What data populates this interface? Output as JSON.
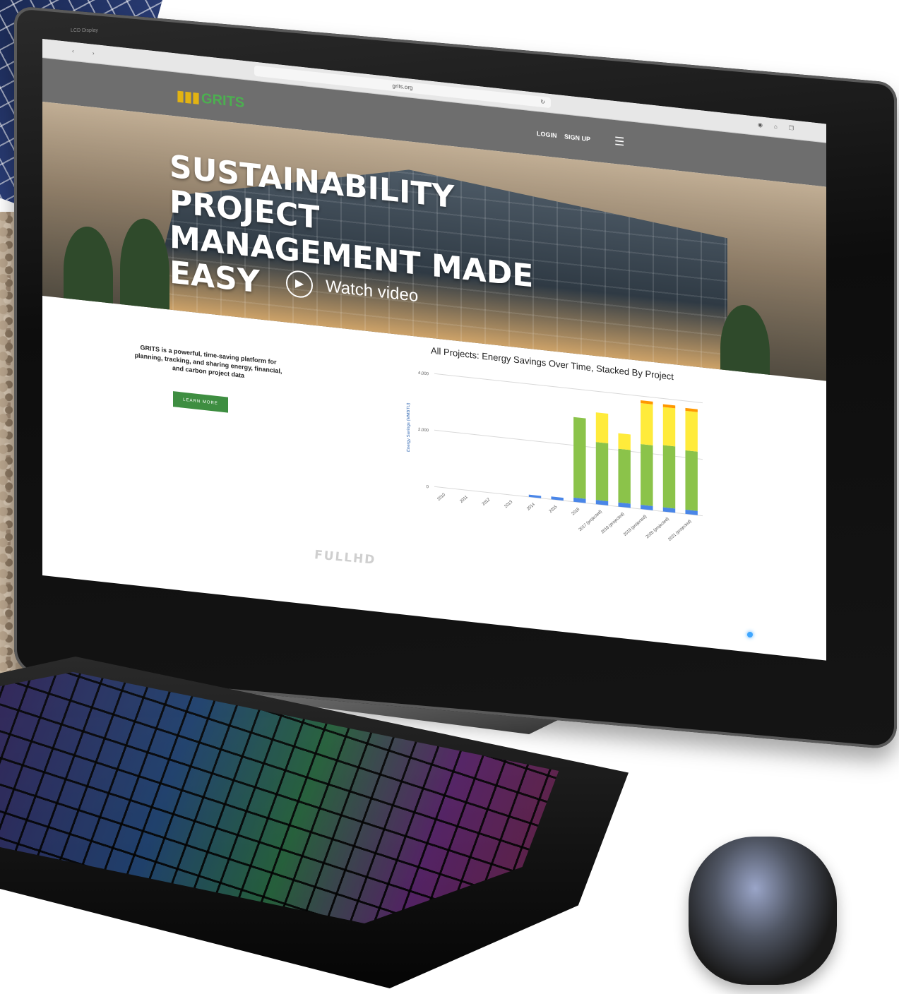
{
  "monitor": {
    "label": "LCD Display",
    "brand": "FULLHD"
  },
  "browser": {
    "url": "grits.org",
    "reload_icon": "reload-icon",
    "tool_icons": [
      "circle-icon",
      "home-icon",
      "pages-icon"
    ]
  },
  "site": {
    "logo_text": "GRITS",
    "nav": {
      "login": "LOGIN",
      "signup": "SIGN UP",
      "menu_icon": "hamburger-icon"
    },
    "hero": {
      "title_line1": "SUSTAINABILITY PROJECT",
      "title_line2": "MANAGEMENT MADE EASY",
      "watch_video": "Watch video"
    },
    "intro": "GRITS is a powerful, time-saving platform for planning, tracking, and sharing energy, financial, and carbon project data",
    "learn_more": "LEARN MORE"
  },
  "colors": {
    "brand_green": "#4caf50",
    "button_green": "#3e8e41",
    "nav_gray": "#6e6e6e"
  },
  "chart_data": {
    "type": "bar",
    "title": "All Projects: Energy Savings Over Time, Stacked By Project",
    "ylabel": "Energy Savings (MMBTU)",
    "ylim": [
      0,
      4000
    ],
    "yticks": [
      "4,000",
      "2,000",
      "0"
    ],
    "categories": [
      "2010",
      "2011",
      "2012",
      "2013",
      "2014",
      "2015",
      "2016",
      "2017 (projected)",
      "2018 (projected)",
      "2019 (projected)",
      "2020 (projected)",
      "2021 (projected)"
    ],
    "series": [
      {
        "color": "#4a86e8",
        "values": [
          0,
          0,
          0,
          0,
          80,
          100,
          150,
          150,
          150,
          150,
          150,
          150
        ]
      },
      {
        "color": "#8bc34a",
        "values": [
          0,
          0,
          0,
          0,
          0,
          0,
          2850,
          2050,
          1900,
          2150,
          2200,
          2100
        ]
      },
      {
        "color": "#ffeb3b",
        "values": [
          0,
          0,
          0,
          0,
          0,
          0,
          0,
          1050,
          550,
          1450,
          1350,
          1400
        ]
      },
      {
        "color": "#ff9800",
        "values": [
          0,
          0,
          0,
          0,
          0,
          0,
          0,
          0,
          0,
          100,
          100,
          100
        ]
      }
    ]
  }
}
